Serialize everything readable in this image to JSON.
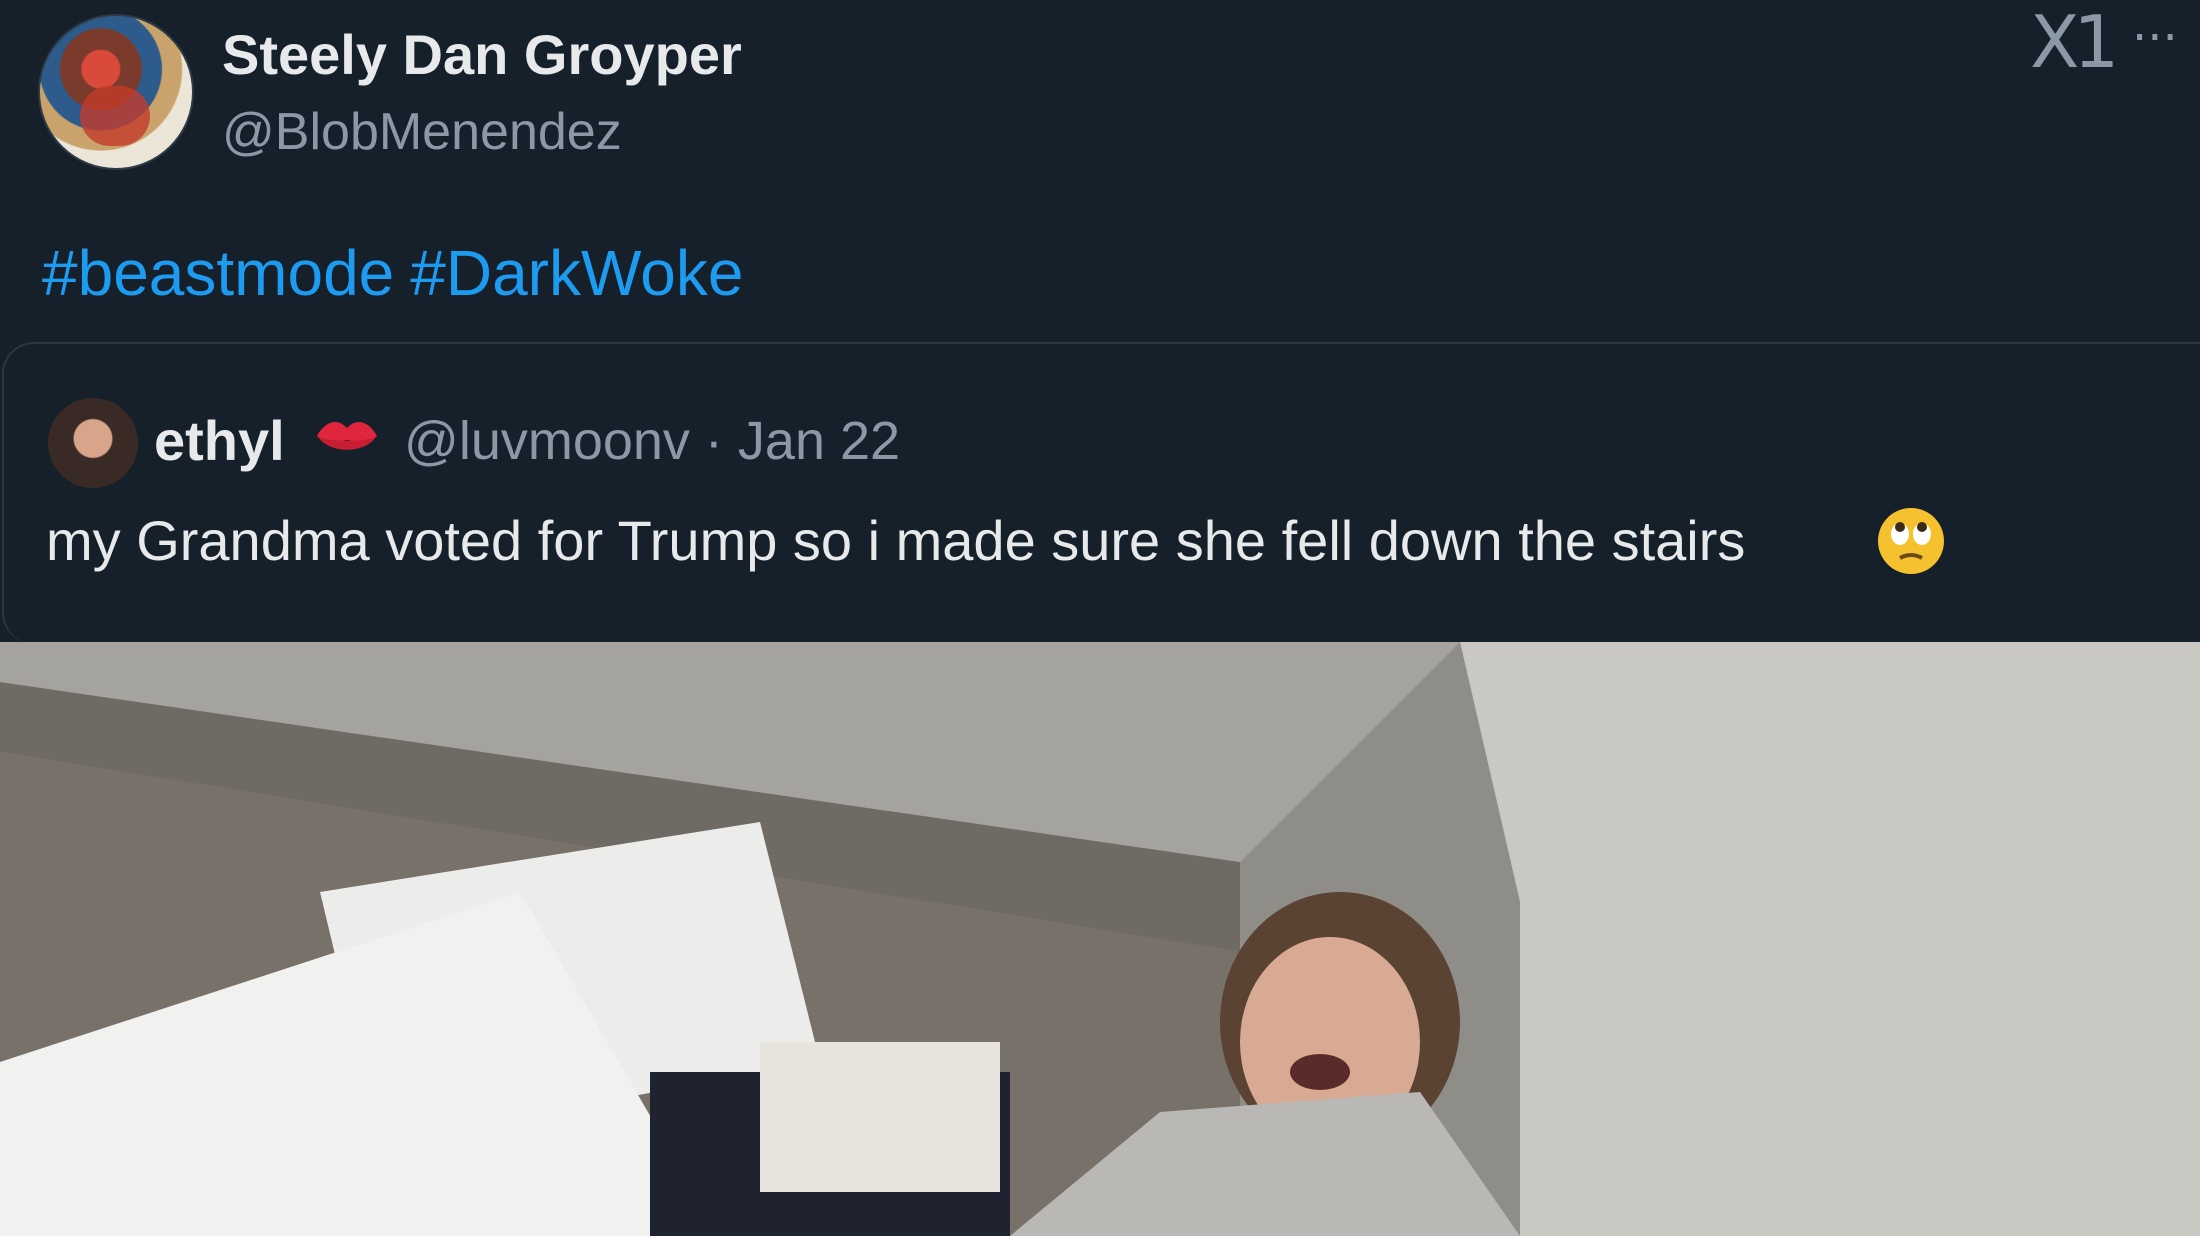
{
  "post": {
    "display_name": "Steely Dan Groyper",
    "handle": "@BlobMenendez",
    "hashtags": [
      "#beastmode",
      "#DarkWoke"
    ],
    "overlay_mark": "X1",
    "more_label": "···"
  },
  "quoted": {
    "display_name": "ethyl",
    "name_emoji": "kiss-mark",
    "handle_date": "@luvmoonv · Jan 22",
    "text": "my Grandma voted for Trump so i made sure she fell down the stairs",
    "trailing_emoji": "face-with-rolling-eyes"
  },
  "media": {
    "icon": "photo-attachment"
  },
  "colors": {
    "background": "#15202b",
    "link": "#1d9bf0",
    "secondary_text": "#8b98a5"
  }
}
